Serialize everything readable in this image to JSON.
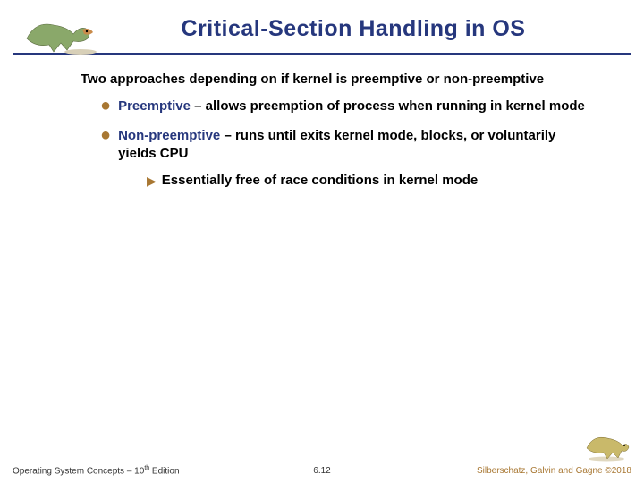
{
  "header": {
    "title": "Critical-Section Handling in OS"
  },
  "body": {
    "intro": "Two approaches depending on if kernel is preemptive or non-preemptive",
    "items": [
      {
        "term": "Preemptive",
        "rest": " – allows preemption of process when running in kernel mode"
      },
      {
        "term": "Non-preemptive",
        "rest": " – runs until exits kernel mode, blocks, or voluntarily yields CPU",
        "sub": "Essentially free of race conditions in kernel mode"
      }
    ]
  },
  "footer": {
    "left_prefix": "Operating System Concepts – 10",
    "left_suffix": " Edition",
    "left_sup": "th",
    "center": "6.12",
    "right": "Silberschatz, Galvin and Gagne ©2018"
  },
  "icons": {
    "dino_left": "dinosaur-icon",
    "dino_right": "dinosaur-icon"
  }
}
